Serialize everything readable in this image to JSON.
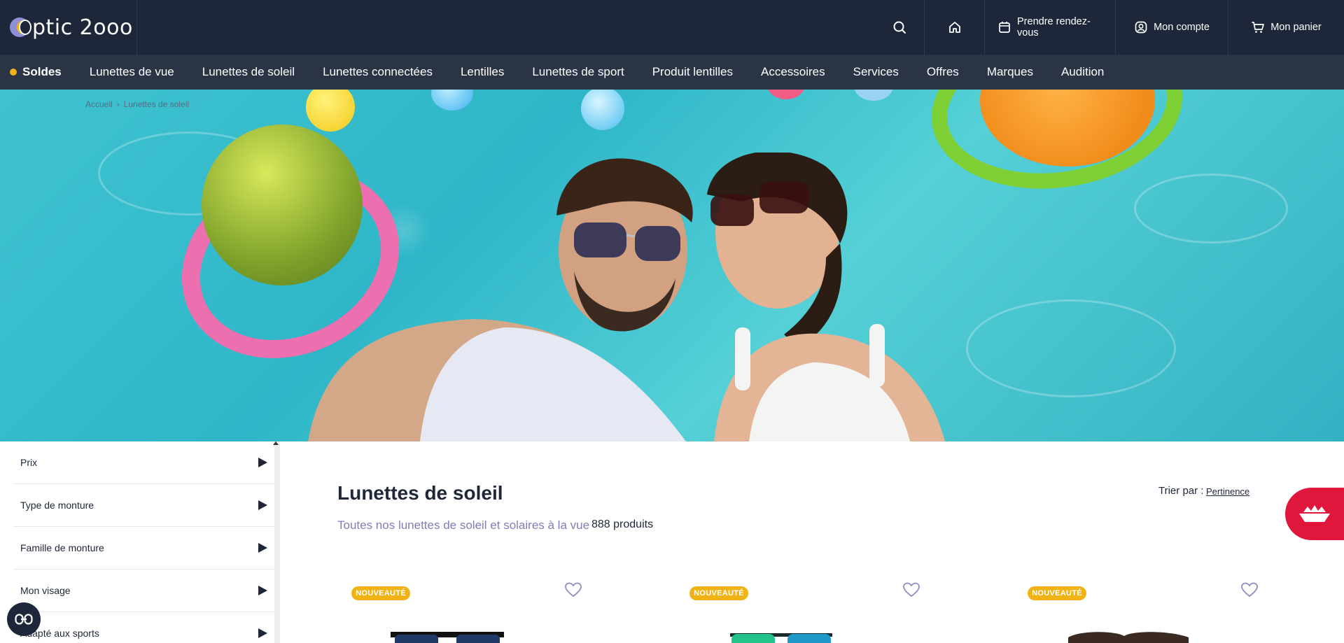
{
  "header": {
    "logo_text": "ptic 2ooo",
    "top_links": [
      {
        "label": "Prendre rendez-vous",
        "icon": "calendar-icon"
      },
      {
        "label": "Mon compte",
        "icon": "user-icon"
      },
      {
        "label": "Mon panier",
        "icon": "cart-icon"
      }
    ]
  },
  "nav": {
    "items": [
      {
        "label": "Soldes"
      },
      {
        "label": "Lunettes de vue"
      },
      {
        "label": "Lunettes de soleil"
      },
      {
        "label": "Lunettes connectées"
      },
      {
        "label": "Lentilles"
      },
      {
        "label": "Lunettes de sport"
      },
      {
        "label": "Produit lentilles"
      },
      {
        "label": "Accessoires"
      },
      {
        "label": "Services"
      },
      {
        "label": "Offres"
      },
      {
        "label": "Marques"
      },
      {
        "label": "Audition"
      }
    ]
  },
  "breadcrumb": {
    "items": [
      "Accueil",
      "Lunettes de soleil"
    ]
  },
  "filters": [
    {
      "label": "Prix"
    },
    {
      "label": "Type de monture"
    },
    {
      "label": "Famille de monture"
    },
    {
      "label": "Mon visage"
    },
    {
      "label": "Adapté aux sports"
    }
  ],
  "listing": {
    "title": "Lunettes de soleil",
    "subtitle": "Toutes nos lunettes de soleil et solaires à la vue",
    "count": "888 produits",
    "sort_label": "Trier par :",
    "sort_value": "Pertinence"
  },
  "products": [
    {
      "badge": "NOUVEAUTÉ"
    },
    {
      "badge": "NOUVEAUTÉ"
    },
    {
      "badge": "NOUVEAUTÉ"
    }
  ],
  "colors": {
    "header_bg": "#1e2739",
    "nav_bg": "#2b3444",
    "accent_yellow": "#f0b316",
    "accent_red": "#e0163d",
    "subtitle_purple": "#7f7fb6"
  }
}
